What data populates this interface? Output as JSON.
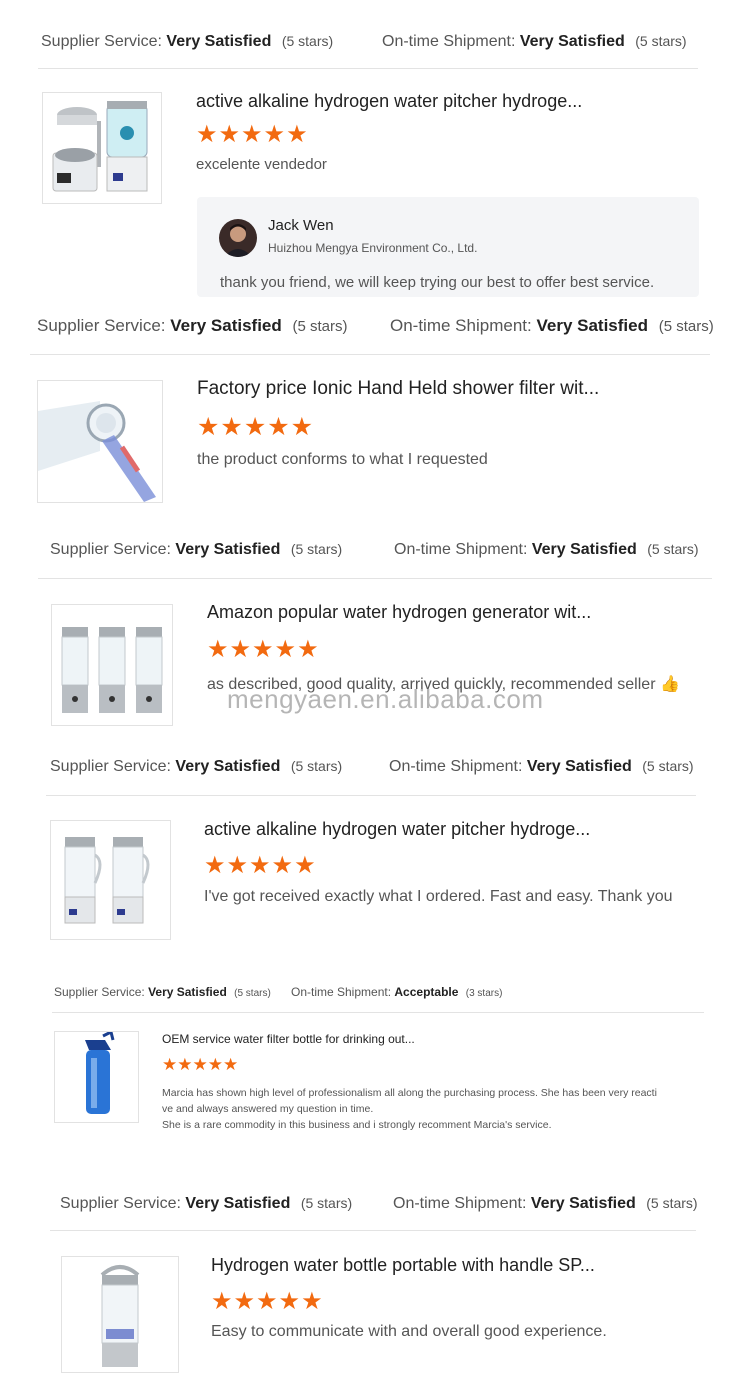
{
  "labels": {
    "supplier_service": "Supplier Service:",
    "ontime_shipment": "On-time Shipment:"
  },
  "reviews": [
    {
      "supplier_value": "Very Satisfied",
      "supplier_stars": "(5 stars)",
      "shipment_value": "Very Satisfied",
      "shipment_stars": "(5 stars)",
      "product_title": "active alkaline hydrogen water pitcher hydroge...",
      "rating": 5,
      "stars_text": "★★★★★",
      "comment": "excelente vendedor",
      "thumb_icon": "hydrogen-pitcher-set-image",
      "reply": {
        "name": "Jack Wen",
        "company": "Huizhou Mengya Environment Co., Ltd.",
        "text": "thank you friend, we will keep trying our best to offer best service."
      }
    },
    {
      "supplier_value": "Very Satisfied",
      "supplier_stars": "(5 stars)",
      "shipment_value": "Very Satisfied",
      "shipment_stars": "(5 stars)",
      "product_title": "Factory price Ionic Hand Held shower filter wit...",
      "rating": 5,
      "stars_text": "★★★★★",
      "comment": "the product conforms to what I requested",
      "thumb_icon": "shower-head-image"
    },
    {
      "supplier_value": "Very Satisfied",
      "supplier_stars": "(5 stars)",
      "shipment_value": "Very Satisfied",
      "shipment_stars": "(5 stars)",
      "product_title": "Amazon popular water hydrogen generator wit...",
      "rating": 5,
      "stars_text": "★★★★★",
      "comment": "as described, good quality, arrived quickly, recommended seller 👍",
      "thumb_icon": "hydrogen-generator-cups-image"
    },
    {
      "supplier_value": "Very Satisfied",
      "supplier_stars": "(5 stars)",
      "shipment_value": "Very Satisfied",
      "shipment_stars": "(5 stars)",
      "product_title": "active alkaline hydrogen water pitcher hydroge...",
      "rating": 5,
      "stars_text": "★★★★★",
      "comment": "I've got received exactly what I ordered. Fast and easy. Thank you",
      "thumb_icon": "hydrogen-pitchers-image"
    },
    {
      "supplier_value": "Very Satisfied",
      "supplier_stars": "(5 stars)",
      "shipment_value": "Acceptable",
      "shipment_stars": "(3 stars)",
      "product_title": "OEM service water filter bottle for drinking out...",
      "rating": 5,
      "stars_text": "★★★★★",
      "comment_lines": [
        "Marcia has shown high level of professionalism all along the purchasing process. She has been very reacti",
        "ve and always answered my question in time.",
        "She is a rare commodity in this business and i strongly recomment Marcia's service."
      ],
      "thumb_icon": "blue-filter-bottle-image"
    },
    {
      "supplier_value": "Very Satisfied",
      "supplier_stars": "(5 stars)",
      "shipment_value": "Very Satisfied",
      "shipment_stars": "(5 stars)",
      "product_title": "Hydrogen water bottle portable with handle SP...",
      "rating": 5,
      "stars_text": "★★★★★",
      "comment": "Easy to communicate with and overall good experience.",
      "thumb_icon": "hydrogen-bottle-handle-image"
    }
  ],
  "watermark": "mengyaen.en.alibaba.com",
  "colors": {
    "star": "#f26a10",
    "reply_bg": "#f4f5f7",
    "divider": "#e3e3e3"
  }
}
